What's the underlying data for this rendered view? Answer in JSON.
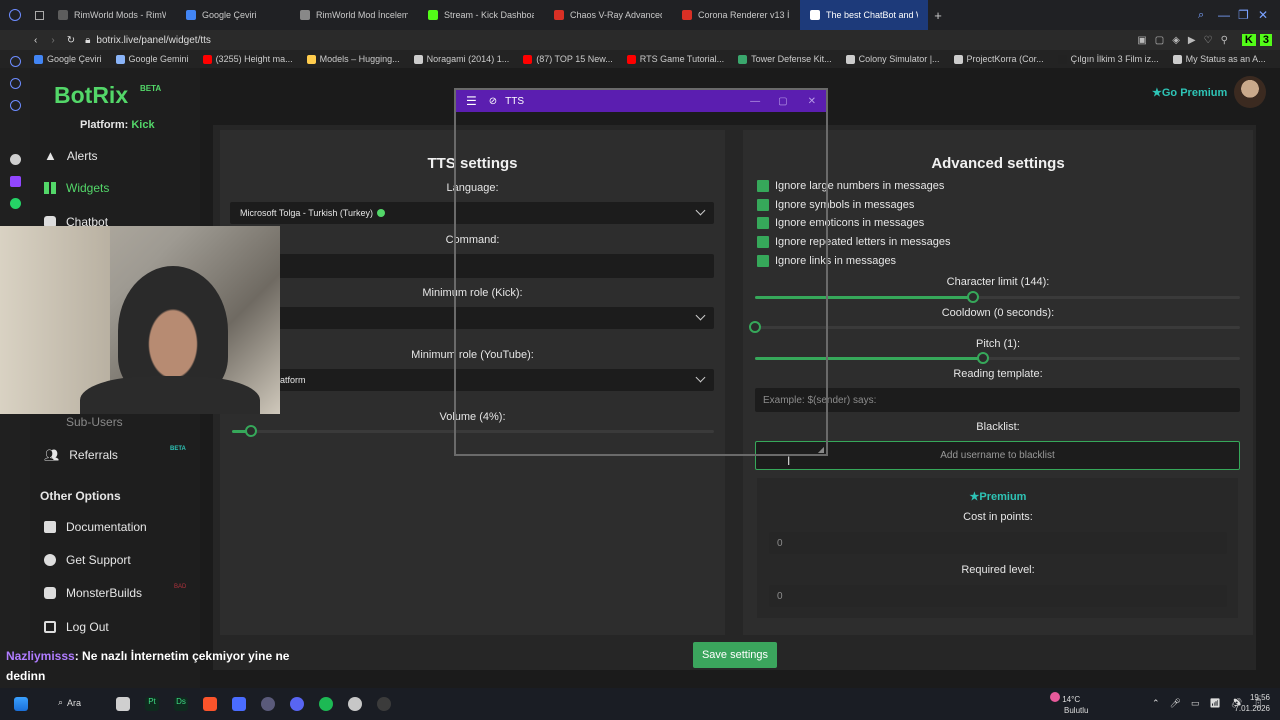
{
  "browser": {
    "tabs": [
      {
        "label": "RimWorld Mods - RimWorld",
        "color": "#5d5d5d"
      },
      {
        "label": "Google Çeviri",
        "color": "#4285f4"
      },
      {
        "label": "RimWorld Mod İncelemesi",
        "color": "#888888"
      },
      {
        "label": "Stream - Kick Dashboard",
        "color": "#53fc18"
      },
      {
        "label": "Chaos V-Ray Advanced Fe",
        "color": "#d93025"
      },
      {
        "label": "Corona Renderer v13 İndir",
        "color": "#d93025"
      },
      {
        "label": "The best ChatBot and Wid",
        "color": "#ffffff",
        "active": true
      }
    ],
    "url": "botrix.live/panel/widget/tts",
    "bookmarks": [
      {
        "label": "Google Çeviri",
        "color": "#4285f4"
      },
      {
        "label": "Google Gemini",
        "color": "#8ab4f8"
      },
      {
        "label": "(3255) Height ma...",
        "color": "#ff0000"
      },
      {
        "label": "Models – Hugging...",
        "color": "#ffcc4d"
      },
      {
        "label": "Noragami (2014) 1...",
        "color": "#cccccc"
      },
      {
        "label": "(87) TOP 15 New...",
        "color": "#ff0000"
      },
      {
        "label": "RTS Game Tutorial...",
        "color": "#ff0000"
      },
      {
        "label": "Tower Defense Kit...",
        "color": "#3aa76d"
      },
      {
        "label": "Colony Simulator |...",
        "color": "#cccccc"
      },
      {
        "label": "ProjectKorra (Cor...",
        "color": "#cccccc"
      },
      {
        "label": "Çılgın İlkim 3 Film iz...",
        "color": "#222222"
      },
      {
        "label": "My Status as an A...",
        "color": "#cccccc"
      }
    ]
  },
  "sidebar": {
    "logo": "BotRix",
    "logo_badge": "BETA",
    "platform_label": "Platform:",
    "platform_value": "Kick",
    "items": {
      "alerts": "Alerts",
      "widgets": "Widgets",
      "chatbot": "Chatbot",
      "subusers": "Sub-Users",
      "referrals": "Referrals",
      "referrals_badge": "BETA"
    },
    "other_heading": "Other Options",
    "other": {
      "documentation": "Documentation",
      "support": "Get Support",
      "monster": "MonsterBuilds",
      "monster_badge": "BAD",
      "logout": "Log Out"
    }
  },
  "header": {
    "premium": "Go Premium"
  },
  "tts": {
    "title": "TTS settings",
    "language_label": "Language:",
    "language_value": "Microsoft Tolga - Turkish (Turkey)",
    "command_label": "Command:",
    "role_kick_label": "Minimum role (Kick):",
    "role_youtube_label": "Minimum role (YouTube):",
    "role_youtube_value": "atform",
    "volume_label": "Volume (4%):",
    "volume_level": 0.04
  },
  "advanced": {
    "title": "Advanced settings",
    "checkboxes": [
      "Ignore large numbers in messages",
      "Ignore symbols in messages",
      "Ignore emoticons in messages",
      "Ignore repeated letters in messages",
      "Ignore links in messages"
    ],
    "char_limit_label": "Character limit (144):",
    "char_limit_level": 0.45,
    "cooldown_label": "Cooldown (0 seconds):",
    "cooldown_level": 0.0,
    "pitch_label": "Pitch (1):",
    "pitch_level": 0.47,
    "template_label": "Reading template:",
    "template_placeholder": "Example: $(sender) says:",
    "blacklist_label": "Blacklist:",
    "blacklist_placeholder": "Add username to blacklist",
    "premium_label": "Premium",
    "cost_label": "Cost in points:",
    "cost_value": "0",
    "level_label": "Required level:",
    "level_value": "0"
  },
  "save_label": "Save settings",
  "overlay_window": {
    "title": "TTS"
  },
  "chat": {
    "user": "Nazliymisss",
    "message": ": Ne nazlı İnternetim çekmiyor yine ne dedinn"
  },
  "taskbar": {
    "search": "Ara",
    "weather_temp": "14°C",
    "weather_desc": "Bulutlu",
    "time": "19:56",
    "date": "7.01.2026"
  }
}
